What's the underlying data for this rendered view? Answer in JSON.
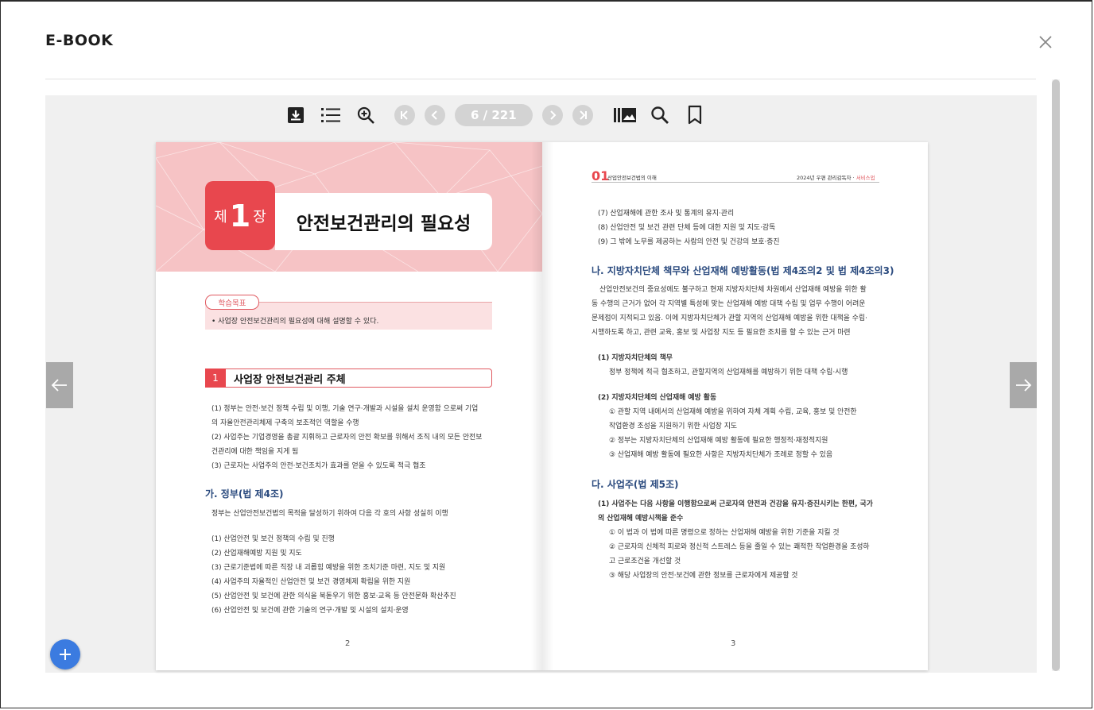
{
  "modal": {
    "title": "E-BOOK"
  },
  "toolbar": {
    "page_indicator": "6 / 221",
    "icons": [
      "download-icon",
      "toc-list-icon",
      "zoom-in-icon",
      "first-page-icon",
      "prev-page-icon",
      "next-page-icon",
      "last-page-icon",
      "thumbnails-icon",
      "search-icon",
      "bookmark-icon"
    ]
  },
  "left_page": {
    "chapter_label_pre": "제",
    "chapter_number": "1",
    "chapter_label_post": "장",
    "chapter_title": "안전보건관리의 필요성",
    "goal_tab": "학습목표",
    "goal_text": "• 사업장 안전보건관리의 필요성에 대해 설명할 수 있다.",
    "section_number": "1",
    "section_title": "사업장 안전보건관리 주체",
    "para_lines": [
      "(1) 정부는 안전·보건 정책 수립 및 이행, 기술 연구·개발과 시설을 설치 운영함 으로써 기업",
      "      의 자율안전관리체제 구축의 보조적인 역할을 수행",
      "(2) 사업주는 기업경영을 총괄 지휘하고 근로자의 안전 확보를 위해서 조직 내의 모든 안전보",
      "      건관리에 대한 책임을 지게 됨",
      "(3) 근로자는 사업주의 안전·보건조치가 효과를 얻을 수 있도록 적극 협조"
    ],
    "subsection_title": "가. 정부(법 제4조)",
    "subsection_intro": "정부는 산업안전보건법의 목적을 달성하기 위하여 다음 각 호의 사항 성실히 이행",
    "list_items": [
      "(1) 산업안전 및 보건 정책의 수립 및 진행",
      "(2) 산업재해예방 지원 및 지도",
      "(3) 근로기준법에 따른 직장 내 괴롭힘 예방을 위한 조치기준 마련, 지도 및 지원",
      "(4) 사업주의 자율적인 산업안전 및 보건 경영체제 확립을 위한 지원",
      "(5) 산업안전 및 보건에 관한 의식을 북돋우기 위한 홍보·교육 등 안전문화 확산추진",
      "(6) 산업안전 및 보건에 관한 기술의 연구·개발 및 시설의 설치·운영"
    ],
    "page_number": "2"
  },
  "right_page": {
    "header_num": "01",
    "header_title": "산업안전보건법의 이해",
    "header_right": "2024년 우편 관리감독자 · ",
    "header_right_accent": "서비스업",
    "top_list": [
      "(7) 산업재해에 관한 조사 및 통계의 유지·관리",
      "(8) 산업안전 및 보건 관련 단체 등에 대한 지원 및 지도·감독",
      "(9) 그 밖에 노무를 제공하는 사람의 안전 및 건강의 보호·증진"
    ],
    "section_na_title": "나. 지방자치단체 책무와 산업재해 예방활동(법 제4조의2 및 법 제4조의3)",
    "section_na_para": [
      "산업안전보건의 중요성에도 불구하고 현재 지방자치단체 차원에서 산업재해 예방을 위한 활",
      "동 수행의 근거가 없어 각 지역별 특성에 맞는 산업재해 예방 대책 수립 및 업무 수행이 어려운",
      "문제점이 지적되고 있음. 이에 지방자치단체가 관할 지역의 산업재해 예방을 위한 대책을 수립·",
      "시행하도록 하고, 관련 교육, 홍보 및 사업장 지도 등 필요한 조치를 할 수 있는 근거 마련"
    ],
    "duty_head": "(1) 지방자치단체의 책무",
    "duty_text": "정부 정책에 적극 협조하고, 관할지역의 산업재해를 예방하기 위한 대책 수립·시행",
    "activity_head": "(2) 지방자치단체의 산업재해 예방 활동",
    "activity_items": [
      "① 관할 지역 내에서의 산업재해 예방을 위하여 자체 계획 수립, 교육, 홍보 및 안전한",
      "    작업환경 조성을 지원하기 위한 사업장 지도",
      "② 정부는 지방자치단체의 산업재해 예방 활동에 필요한 행정적·재정적지원",
      "③ 산업재해 예방 활동에 필요한 사항은 지방자치단체가 조례로 정할 수 있음"
    ],
    "section_da_title": "다. 사업주(법 제5조)",
    "employer_head_1": "(1) 사업주는 다음 사항을 이행함으로써 근로자의 안전과 건강을 유지·증진시키는 한편, 국가",
    "employer_head_2": "     의 산업재해 예방시책을 준수",
    "employer_items": [
      "① 이 법과 이 법에 따른 명령으로 정하는 산업재해 예방을 위한 기준을  지킬 것",
      "② 근로자의 신체적 피로와 정신적 스트레스 등을 줄일 수 있는 쾌적한 작업환경을 조성하",
      "    고 근로조건을 개선할 것",
      "③ 해당 사업장의 안전·보건에 관한 정보를 근로자에게 제공할 것"
    ],
    "page_number": "3"
  },
  "colors": {
    "accent_red": "#e8474e",
    "band_pink": "#f6c3c5",
    "heading_blue": "#2a4a7e",
    "fab_blue": "#3b7be0"
  }
}
